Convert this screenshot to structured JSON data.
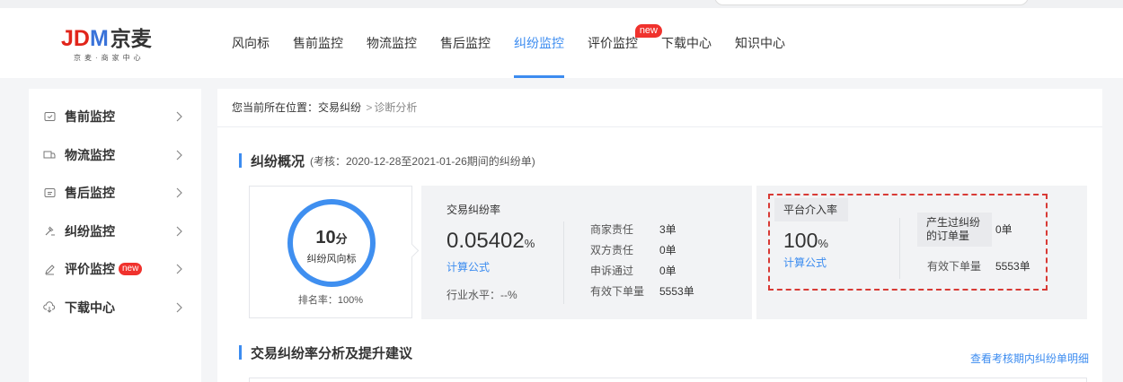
{
  "logo": {
    "main_jd": "JD",
    "main_m": "M",
    "main_cn": "京麦",
    "sub": "京麦·商家中心"
  },
  "nav": {
    "items": [
      {
        "label": "风向标"
      },
      {
        "label": "售前监控"
      },
      {
        "label": "物流监控"
      },
      {
        "label": "售后监控"
      },
      {
        "label": "纠纷监控"
      },
      {
        "label": "评价监控"
      },
      {
        "label": "下载中心"
      },
      {
        "label": "知识中心"
      }
    ],
    "active": "纠纷监控",
    "badge": "new"
  },
  "sidebar": {
    "items": [
      {
        "label": "售前监控"
      },
      {
        "label": "物流监控"
      },
      {
        "label": "售后监控"
      },
      {
        "label": "纠纷监控"
      },
      {
        "label": "评价监控",
        "badge": "new"
      },
      {
        "label": "下载中心"
      }
    ]
  },
  "breadcrumb": {
    "prefix": "您当前所在位置：",
    "parent": "交易纠纷",
    "sep": ">",
    "current": "诊断分析"
  },
  "overview": {
    "title": "纠纷概况",
    "note": "(考核：2020-12-28至2021-01-26期间的纠纷单)",
    "score": {
      "value": "10",
      "unit": "分",
      "label": "纠纷风向标",
      "rank": "排名率：100%"
    },
    "rate": {
      "title": "交易纠纷率",
      "value": "0.05402",
      "pct": "%",
      "link": "计算公式",
      "industry": "行业水平：--%",
      "rows": [
        {
          "k": "商家责任",
          "v": "3单"
        },
        {
          "k": "双方责任",
          "v": "0单"
        },
        {
          "k": "申诉通过",
          "v": "0单"
        },
        {
          "k": "有效下单量",
          "v": "5553单"
        }
      ]
    },
    "platform": {
      "title": "平台介入率",
      "value": "100",
      "pct": "%",
      "link": "计算公式",
      "k1_line1": "产生过纠纷",
      "k1_line2": "的订单量",
      "v1": "0单",
      "k2": "有效下单量",
      "v2": "5553单"
    }
  },
  "analysis": {
    "title": "交易纠纷率分析及提升建议",
    "detail_link": "查看考核期内纠纷单明细"
  }
}
